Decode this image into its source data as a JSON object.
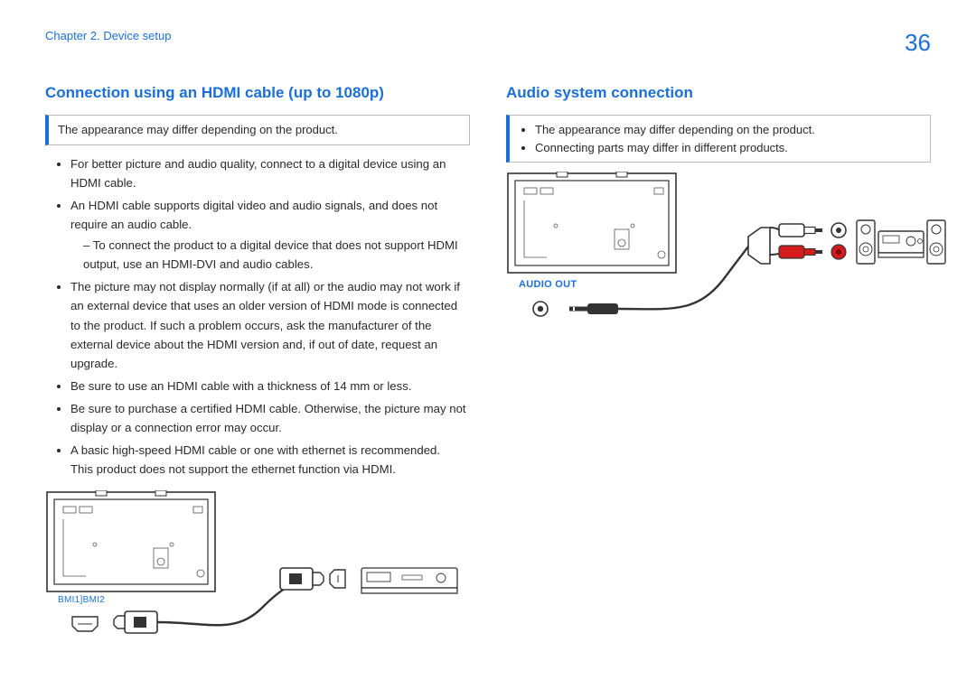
{
  "header": {
    "breadcrumb": "Chapter 2. Device setup",
    "page_number": "36"
  },
  "left": {
    "heading": "Connection using an HDMI cable (up to 1080p)",
    "note": "The appearance may differ depending on the product.",
    "bullets": {
      "b1": "For better picture and audio quality, connect to a digital device using an HDMI cable.",
      "b2": "An HDMI cable supports digital video and audio signals, and does not require an audio cable.",
      "b2_sub1": "To connect the product to a digital device that does not support HDMI output, use an HDMI-DVI and audio cables.",
      "b3": "The picture may not display normally (if at all) or the audio may not work if an external device that uses an older version of HDMI mode is connected to the product. If such a problem occurs, ask the manufacturer of the external device about the HDMI version and, if out of date, request an upgrade.",
      "b4": "Be sure to use an HDMI cable with a thickness of 14 mm or less.",
      "b5": "Be sure to purchase a certified HDMI cable. Otherwise, the picture may not display or a connection error may occur.",
      "b6": "A basic high-speed HDMI cable or one with ethernet is recommended.",
      "b6_extra": "This product does not support the ethernet function via HDMI."
    },
    "port_label": "BMI1]BMI2"
  },
  "right": {
    "heading": "Audio system connection",
    "note_b1": "The appearance may differ depending on the product.",
    "note_b2": "Connecting parts may differ in different products.",
    "port_label": "AUDIO OUT"
  }
}
